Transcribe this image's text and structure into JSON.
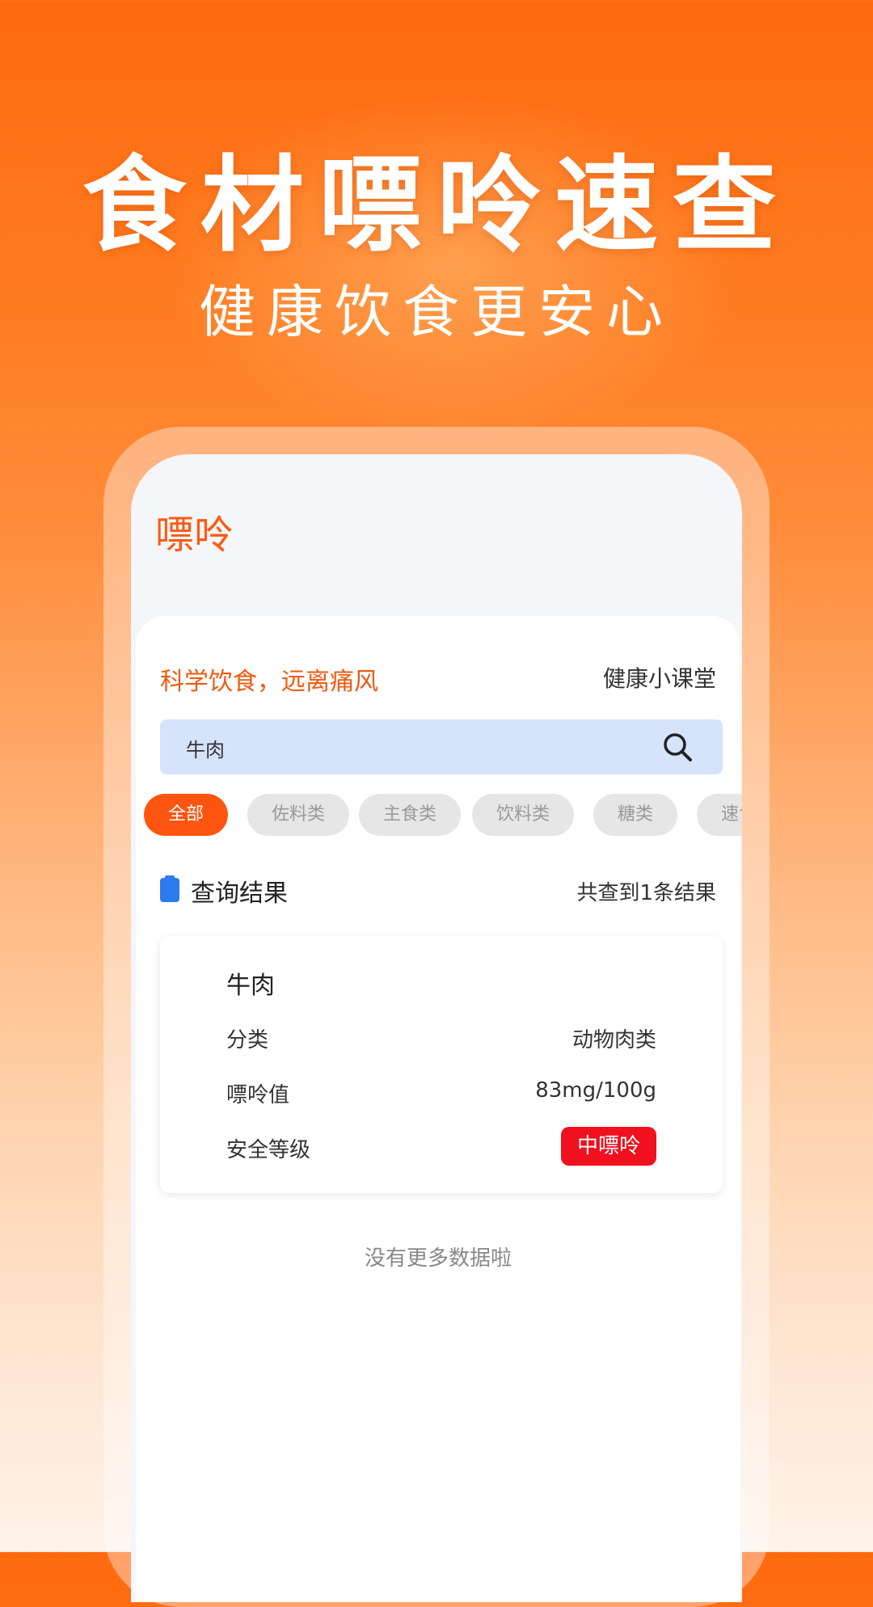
{
  "hero": {
    "title": "食材嘌呤速查",
    "subtitle": "健康饮食更安心"
  },
  "app": {
    "title": "嘌呤"
  },
  "header": {
    "slogan": "科学饮食，远离痛风",
    "class_link": "健康小课堂"
  },
  "search": {
    "value": "牛肉",
    "icon": "search-icon"
  },
  "categories": [
    "全部",
    "佐料类",
    "主食类",
    "饮料类",
    "糖类",
    "速食"
  ],
  "results": {
    "title": "查询结果",
    "count": "共查到1条结果",
    "icon": "clipboard-icon"
  },
  "item": {
    "name": "牛肉",
    "category_label": "分类",
    "category_value": "动物肉类",
    "purine_label": "嘌呤值",
    "purine_value": "83mg/100g",
    "level_label": "安全等级",
    "level_value": "中嘌呤"
  },
  "footer": {
    "no_more": "没有更多数据啦"
  },
  "colors": {
    "accent": "#ff5510",
    "badge": "#f0101e",
    "search_bg": "#d6e4fb",
    "section_icon": "#2d7bf0"
  }
}
